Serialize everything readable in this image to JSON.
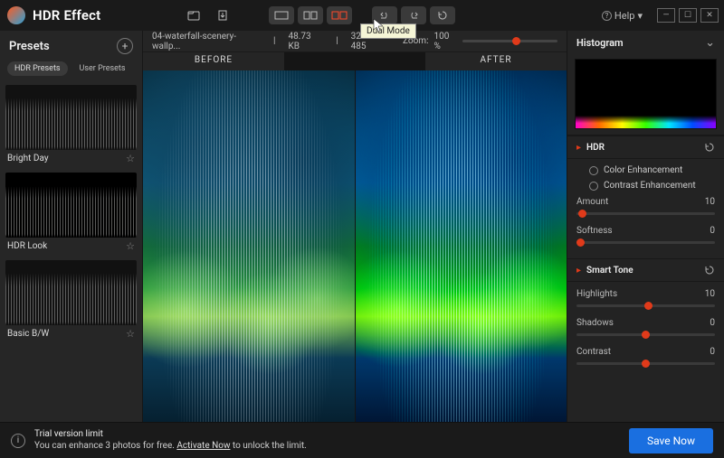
{
  "app": {
    "title": "HDR Effect"
  },
  "titlebar": {
    "help": "Help",
    "tooltip": "Dual Mode"
  },
  "sidebar": {
    "title": "Presets",
    "tabs": [
      "HDR Presets",
      "User Presets"
    ],
    "presets": [
      {
        "name": "Bright Day"
      },
      {
        "name": "HDR Look"
      },
      {
        "name": "Basic B/W"
      }
    ]
  },
  "info": {
    "filename": "04-waterfall-scenery-wallp...",
    "filesize": "48.73 KB",
    "dimensions": "325 X 485",
    "zoom_label": "Zoom:",
    "zoom_value": "100 %"
  },
  "compare": {
    "before": "BEFORE",
    "after": "AFTER"
  },
  "panel": {
    "histogram": "Histogram",
    "hdr": {
      "title": "HDR",
      "opt1": "Color Enhancement",
      "opt2": "Contrast Enhancement",
      "amount_label": "Amount",
      "amount_value": "10",
      "softness_label": "Softness",
      "softness_value": "0"
    },
    "smarttone": {
      "title": "Smart Tone",
      "highlights_label": "Highlights",
      "highlights_value": "10",
      "shadows_label": "Shadows",
      "shadows_value": "0",
      "contrast_label": "Contrast",
      "contrast_value": "0"
    }
  },
  "footer": {
    "title": "Trial version limit",
    "line_a": "You can enhance 3 photos for free. ",
    "activate": "Activate Now",
    "line_b": " to unlock the limit.",
    "save": "Save Now"
  }
}
